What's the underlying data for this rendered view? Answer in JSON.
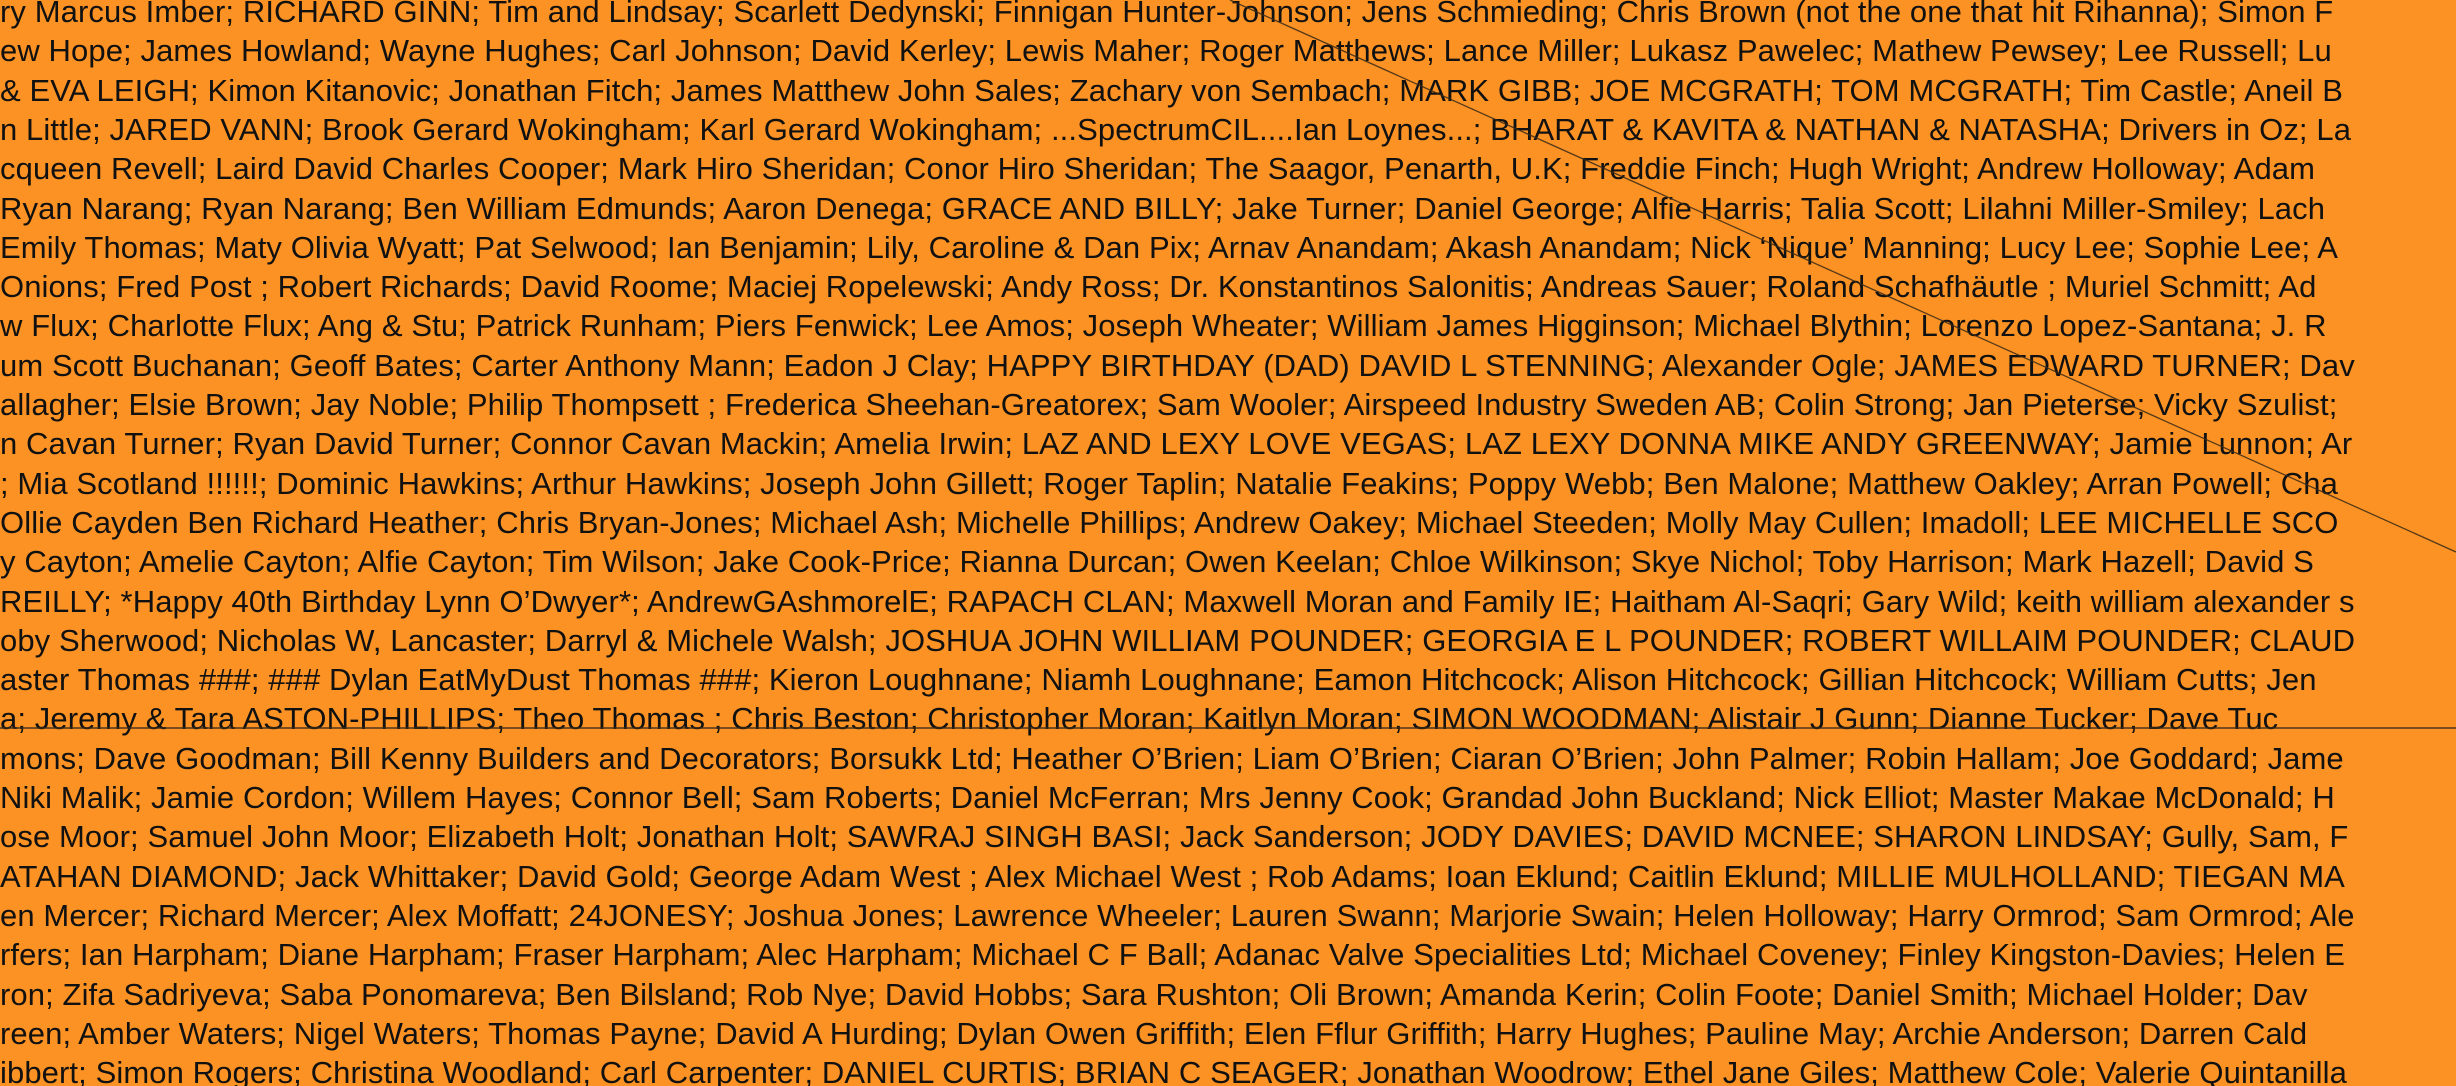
{
  "page": {
    "background_color": "#FB9223",
    "text_color": "#111111",
    "seam_line_color": "#3A2A18"
  },
  "names_wall": {
    "lines": [
      "ry Marcus Imber; RICHARD GINN; Tim and Lindsay; Scarlett Dedynski; Finnigan Hunter-Johnson; Jens Schmieding; Chris Brown (not the one that hit Rihanna); Simon F",
      "ew Hope; James Howland; Wayne Hughes; Carl Johnson; David Kerley; Lewis Maher; Roger Matthews; Lance Miller; Lukasz Pawelec; Mathew Pewsey; Lee Russell; Lu",
      "& EVA LEIGH; Kimon Kitanovic; Jonathan Fitch; James Matthew John Sales; Zachary von Sembach; MARK GIBB; JOE MCGRATH; TOM MCGRATH; Tim Castle; Aneil B",
      "n Little; JARED VANN; Brook Gerard Wokingham; Karl Gerard Wokingham; ...SpectrumCIL....Ian Loynes...; BHARAT & KAVITA & NATHAN & NATASHA; Drivers in Oz; La",
      "cqueen Revell; Laird David Charles Cooper; Mark Hiro Sheridan; Conor Hiro Sheridan; The Saagor, Penarth, U.K; Freddie Finch; Hugh Wright; Andrew Holloway; Adam",
      "Ryan Narang; Ryan Narang; Ben William Edmunds; Aaron Denega; GRACE AND BILLY; Jake Turner; Daniel George; Alfie Harris; Talia Scott; Lilahni Miller-Smiley; Lach",
      "Emily Thomas; Maty Olivia Wyatt; Pat Selwood; Ian Benjamin; Lily, Caroline & Dan Pix; Arnav Anandam; Akash Anandam; Nick ‘Nique’ Manning; Lucy Lee; Sophie Lee; A",
      "Onions; Fred Post ; Robert Richards; David Roome; Maciej Ropelewski; Andy Ross; Dr. Konstantinos Salonitis; Andreas Sauer; Roland Schafhäutle ; Muriel Schmitt; Ad",
      "w Flux; Charlotte Flux; Ang & Stu; Patrick Runham; Piers Fenwick; Lee Amos; Joseph Wheater; William James Higginson; Michael Blythin; Lorenzo Lopez-Santana; J. R",
      "um Scott Buchanan; Geoff Bates; Carter Anthony Mann; Eadon J Clay; HAPPY BIRTHDAY (DAD) DAVID L STENNING; Alexander Ogle; JAMES EDWARD TURNER; Dav",
      "allagher; Elsie Brown; Jay Noble; Philip Thompsett ; Frederica Sheehan-Greatorex; Sam Wooler; Airspeed Industry Sweden AB; Colin Strong; Jan Pieterse; Vicky Szulist;",
      "n Cavan Turner; Ryan David Turner; Connor Cavan Mackin; Amelia Irwin; LAZ AND LEXY LOVE VEGAS; LAZ LEXY DONNA MIKE ANDY GREENWAY; Jamie Lunnon; Ar",
      "; Mia Scotland !!!!!!; Dominic Hawkins; Arthur Hawkins; Joseph John Gillett; Roger Taplin; Natalie Feakins; Poppy Webb; Ben Malone; Matthew Oakley; Arran Powell; Cha",
      "Ollie Cayden Ben Richard Heather; Chris Bryan-Jones; Michael Ash; Michelle Phillips; Andrew Oakey; Michael Steeden; Molly May Cullen; Imadoll; LEE MICHELLE SCO",
      "y Cayton; Amelie Cayton; Alfie Cayton; Tim Wilson; Jake Cook-Price; Rianna Durcan; Owen Keelan; Chloe Wilkinson; Skye Nichol; Toby Harrison; Mark Hazell; David S",
      "REILLY; *Happy 40th Birthday Lynn O’Dwyer*; AndrewGAshmorelE; RAPACH CLAN; Maxwell Moran and Family IE; Haitham Al-Saqri; Gary Wild; keith william alexander s",
      "oby Sherwood; Nicholas W, Lancaster; Darryl & Michele Walsh; JOSHUA JOHN WILLIAM POUNDER; GEORGIA E L POUNDER; ROBERT WILLAIM POUNDER; CLAUD",
      "aster Thomas ###; ### Dylan EatMyDust Thomas ###; Kieron Loughnane; Niamh Loughnane; Eamon Hitchcock; Alison Hitchcock; Gillian Hitchcock; William Cutts; Jen",
      "a; Jeremy & Tara ASTON-PHILLIPS; Theo Thomas ; Chris Beston; Christopher Moran; Kaitlyn Moran; SIMON WOODMAN; Alistair J Gunn; Dianne Tucker; Dave Tuc",
      "mons; Dave Goodman; Bill Kenny Builders and Decorators; Borsukk Ltd; Heather O’Brien; Liam O’Brien; Ciaran O’Brien; John Palmer; Robin Hallam; Joe Goddard; Jame",
      "Niki Malik; Jamie Cordon; Willem Hayes; Connor Bell; Sam Roberts; Daniel McFerran; Mrs Jenny Cook; Grandad John Buckland; Nick Elliot; Master Makae McDonald; H",
      "ose Moor; Samuel John Moor; Elizabeth Holt; Jonathan Holt; SAWRAJ SINGH BASI; Jack Sanderson; JODY DAVIES; DAVID MCNEE; SHARON LINDSAY; Gully, Sam, F",
      "ATAHAN DIAMOND; Jack Whittaker; David Gold; George Adam West ; Alex Michael West ; Rob Adams; Ioan Eklund; Caitlin Eklund; MILLIE MULHOLLAND; TIEGAN MA",
      "en Mercer; Richard Mercer; Alex Moffatt; 24JONESY; Joshua Jones; Lawrence Wheeler; Lauren Swann; Marjorie Swain; Helen Holloway; Harry Ormrod; Sam Ormrod; Ale",
      "rfers; Ian Harpham; Diane Harpham; Fraser Harpham; Alec Harpham; Michael C F Ball; Adanac Valve Specialities Ltd; Michael Coveney; Finley Kingston-Davies; Helen E",
      "ron; Zifa Sadriyeva; Saba Ponomareva; Ben Bilsland; Rob Nye; David Hobbs; Sara Rushton; Oli Brown; Amanda Kerin; Colin Foote; Daniel Smith; Michael Holder; Dav",
      "reen; Amber Waters; Nigel Waters; Thomas Payne; David A Hurding; Dylan Owen Griffith; Elen Fflur Griffith; Harry Hughes; Pauline May; Archie Anderson; Darren Cald",
      "ibbert; Simon Rogers; Christina Woodland; Carl Carpenter; DANIEL CURTIS; BRIAN C SEAGER; Jonathan Woodrow; Ethel Jane Giles; Matthew Cole; Valerie Quintanilla"
    ]
  }
}
